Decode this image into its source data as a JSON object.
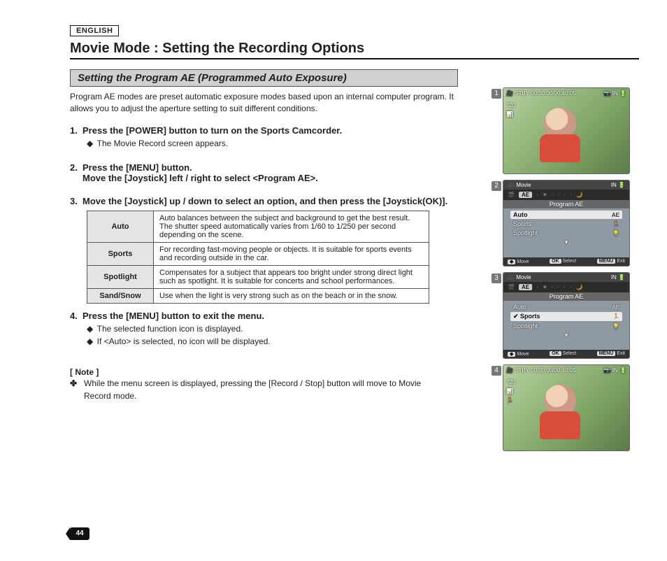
{
  "lang_tag": "ENGLISH",
  "title": "Movie Mode : Setting the Recording Options",
  "subtitle": "Setting the Program AE (Programmed Auto Exposure)",
  "intro": "Program AE modes are preset automatic exposure modes based upon an internal computer program. It allows you to adjust the aperture setting to suit different conditions.",
  "steps": {
    "s1": "Press the [POWER] button to turn on the Sports Camcorder.",
    "s1a": "The Movie Record screen appears.",
    "s2a": "Press the [MENU] button.",
    "s2b": "Move the [Joystick] left / right to select <Program AE>.",
    "s3": "Move the [Joystick] up / down to select an option, and then press the [Joystick(OK)].",
    "s4": "Press the [MENU] button to exit the menu.",
    "s4a": "The selected function icon is displayed.",
    "s4b": "If <Auto> is selected, no icon will be displayed."
  },
  "table": {
    "r1h": "Auto",
    "r1d": "Auto balances between the subject and background to get the best result. The shutter speed automatically varies from 1/60 to 1/250 per second depending on the scene.",
    "r2h": "Sports",
    "r2d": "For recording fast-moving people or objects. It is suitable for sports events and recording outside in the car.",
    "r3h": "Spotlight",
    "r3d": "Compensates for a subject that appears too bright under strong direct light such as spotlight. It is suitable for concerts and school performances.",
    "r4h": "Sand/Snow",
    "r4d": "Use when the light is very strong such as on the beach or in the snow."
  },
  "note_h": "[ Note ]",
  "note_b": "While the menu screen is displayed, pressing the [Record / Stop] button will move to Movie Record mode.",
  "page_no": "44",
  "lcd": {
    "stby": "STBY",
    "tc": "00:00:00/00:40:05",
    "in": "IN",
    "res": "720",
    "mode": "Movie",
    "menu_title": "Program AE",
    "ae_tab": "AE",
    "opt_auto": "Auto",
    "opt_sports": "Sports",
    "opt_spot": "Spotlight",
    "ic_ae": "AE",
    "ic_run": "🏃",
    "ic_spot": "💡",
    "f_move": "Move",
    "f_sel": "Select",
    "f_exit": "Exit",
    "f_ok": "OK",
    "f_menu": "MENU",
    "f_arrow": "◆"
  }
}
